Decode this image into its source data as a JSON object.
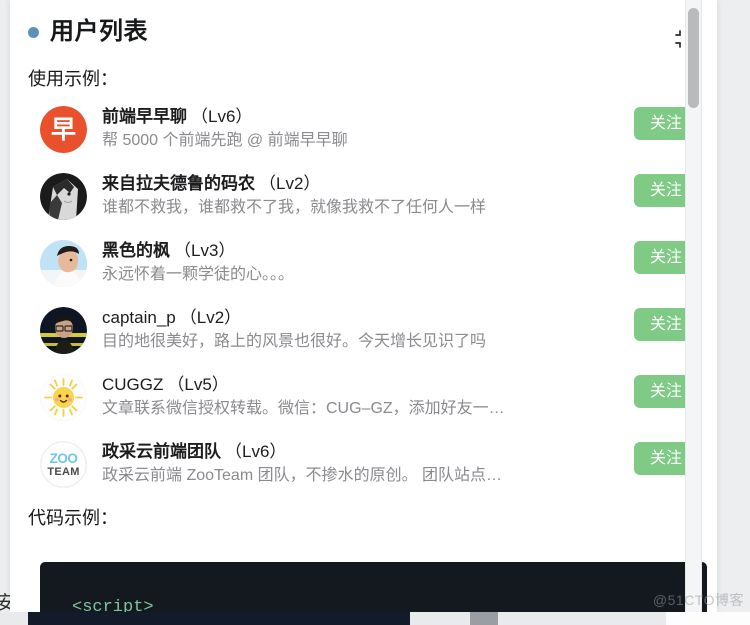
{
  "section": {
    "title": "用户列表",
    "bullet_color": "#5a93b9",
    "collapse_icon": "collapse-icon"
  },
  "labels": {
    "usage_example": "使用示例：",
    "code_example": "代码示例："
  },
  "users": [
    {
      "name": "前端早早聊",
      "level": "（Lv6）",
      "description": "帮 5000 个前端先跑 @ 前端早早聊",
      "avatar": "avatar-text-orange",
      "avatar_text": "早",
      "avatar_bg": "#e8512b",
      "follow_label": "关注",
      "latin_name": false
    },
    {
      "name": "来自拉夫德鲁的码农",
      "level": "（Lv2）",
      "description": "谁都不救我，谁都救不了我，就像我救不了任何人一样",
      "avatar": "avatar-anime-dark",
      "avatar_text": "",
      "avatar_bg": "#2b2b2b",
      "follow_label": "关注",
      "latin_name": false
    },
    {
      "name": "黑色的枫",
      "level": "（Lv3）",
      "description": "永远怀着一颗学徒的心。。。",
      "avatar": "avatar-photo-blue",
      "avatar_text": "",
      "avatar_bg": "#9fd2ef",
      "follow_label": "关注",
      "latin_name": false
    },
    {
      "name": "captain_p",
      "level": "（Lv2）",
      "description": "目的地很美好，路上的风景也很好。今天增长见识了吗",
      "avatar": "avatar-photo-night",
      "avatar_text": "",
      "avatar_bg": "#0f1623",
      "follow_label": "关注",
      "latin_name": true
    },
    {
      "name": "CUGGZ",
      "level": "（Lv5）",
      "description": "文章联系微信授权转载。微信：CUG–GZ，添加好友一…",
      "avatar": "avatar-sun-emoji",
      "avatar_text": "",
      "avatar_bg": "#fdfdfd",
      "follow_label": "关注",
      "latin_name": true
    },
    {
      "name": "政采云前端团队",
      "level": "（Lv6）",
      "description": "政采云前端 ZooTeam 团队，不掺水的原创。 团队站点…",
      "avatar": "avatar-zooteam-logo",
      "avatar_text": "ZOO TEAM",
      "avatar_bg": "#ffffff",
      "follow_label": "关注",
      "latin_name": false
    }
  ],
  "code_block": {
    "visible_line": "<script>",
    "background": "#14181f",
    "text_color": "#7ec699"
  },
  "background_page": {
    "clipped_glyph": "安"
  },
  "watermark": {
    "text": "@51CTO博客"
  }
}
